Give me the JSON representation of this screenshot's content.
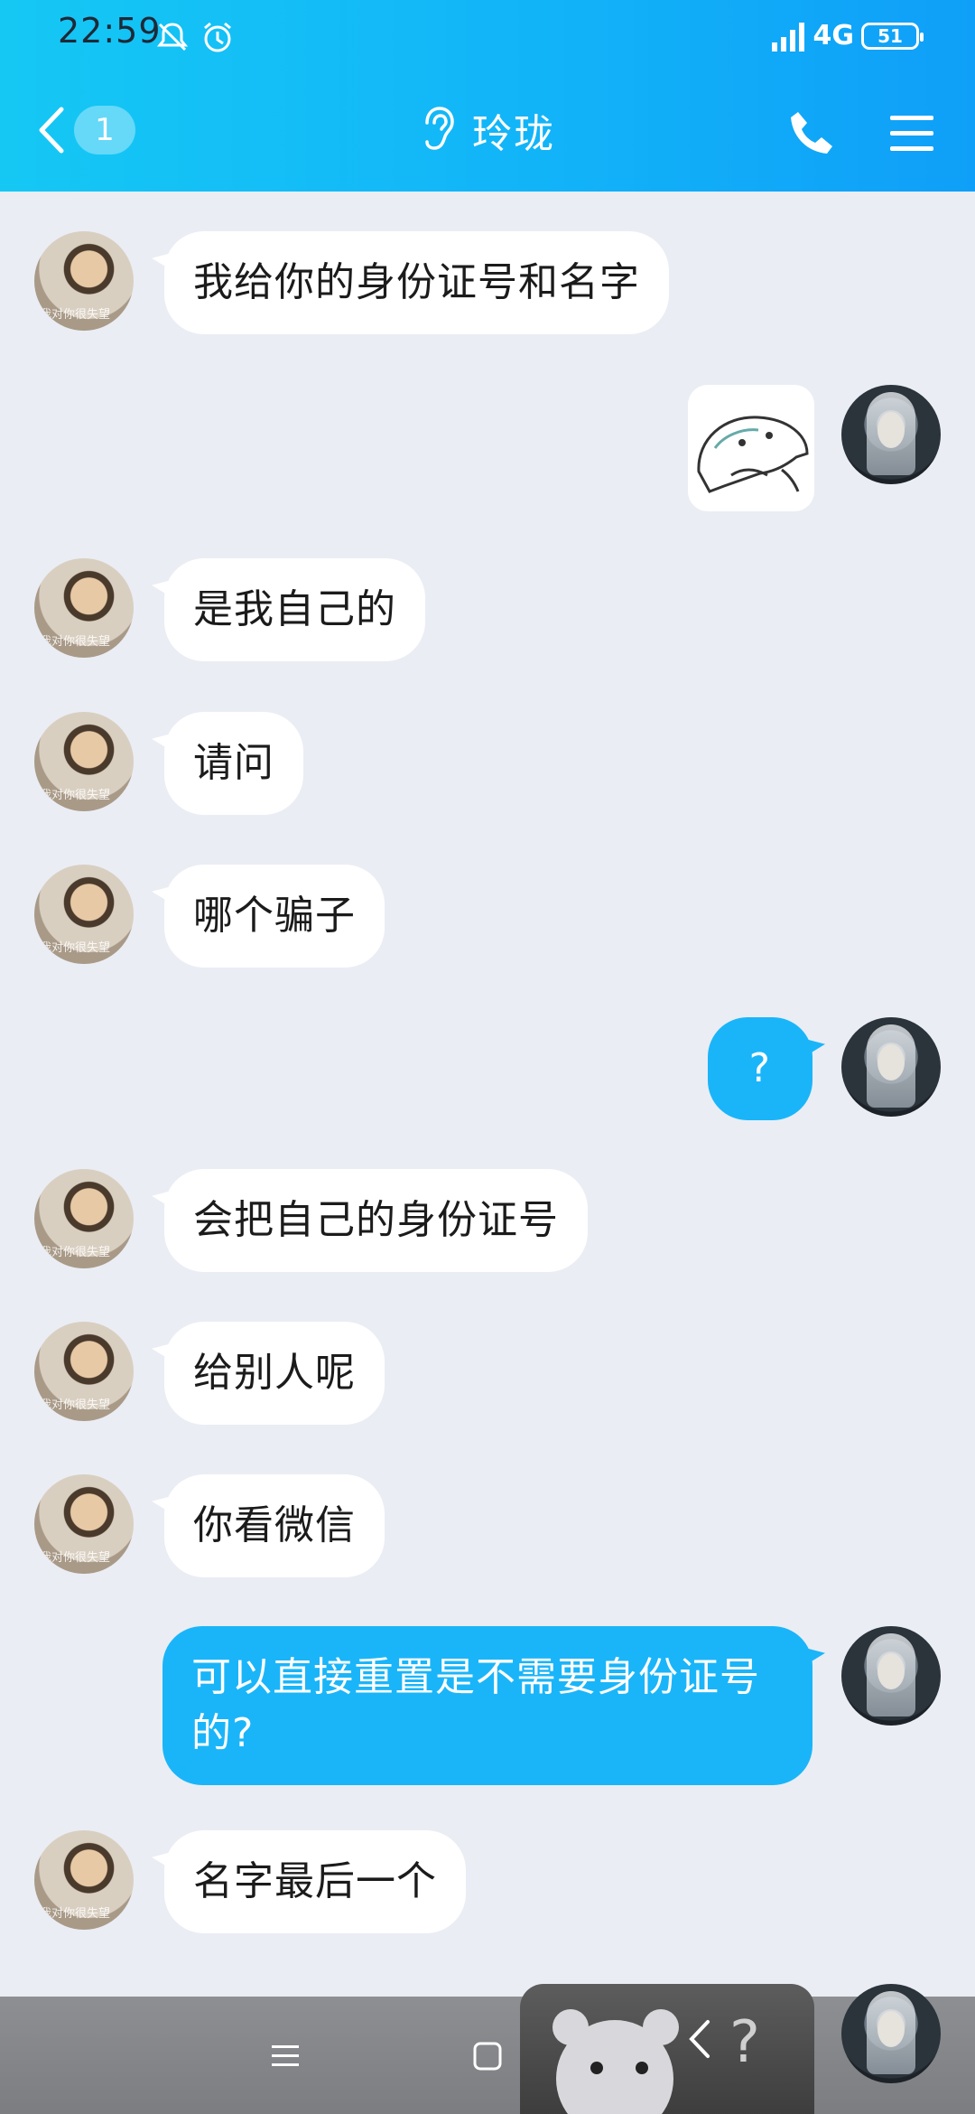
{
  "status_bar": {
    "time": "22:59",
    "network": "4G",
    "battery": "51"
  },
  "header": {
    "unread_count": "1",
    "title": "玲珑"
  },
  "messages": [
    {
      "side": "friend",
      "type": "text",
      "text": "我给你的身份证号和名字"
    },
    {
      "side": "self",
      "type": "sticker"
    },
    {
      "side": "friend",
      "type": "text",
      "text": "是我自己的"
    },
    {
      "side": "friend",
      "type": "text",
      "text": "请问"
    },
    {
      "side": "friend",
      "type": "text",
      "text": "哪个骗子"
    },
    {
      "side": "self",
      "type": "text",
      "text": "?"
    },
    {
      "side": "friend",
      "type": "text",
      "text": "会把自己的身份证号"
    },
    {
      "side": "friend",
      "type": "text",
      "text": "给别人呢"
    },
    {
      "side": "friend",
      "type": "text",
      "text": "你看微信"
    },
    {
      "side": "self",
      "type": "text",
      "text": "可以直接重置是不需要身份证号的?"
    },
    {
      "side": "friend",
      "type": "text",
      "text": "名字最后一个"
    }
  ],
  "friend_avatar_caption": "我对你很失望",
  "floating_window": {
    "label": "?"
  },
  "icons": {
    "back": "chevron-left-icon",
    "ear": "ear-icon",
    "call": "phone-icon",
    "menu": "hamburger-menu-icon",
    "mute": "bell-off-icon",
    "alarm": "alarm-icon",
    "signal": "signal-icon"
  },
  "colors": {
    "header_start": "#15c8f4",
    "header_end": "#0f9ff8",
    "self_bubble": "#1ab5f9",
    "friend_bubble": "#ffffff",
    "background": "#eaedf4"
  }
}
